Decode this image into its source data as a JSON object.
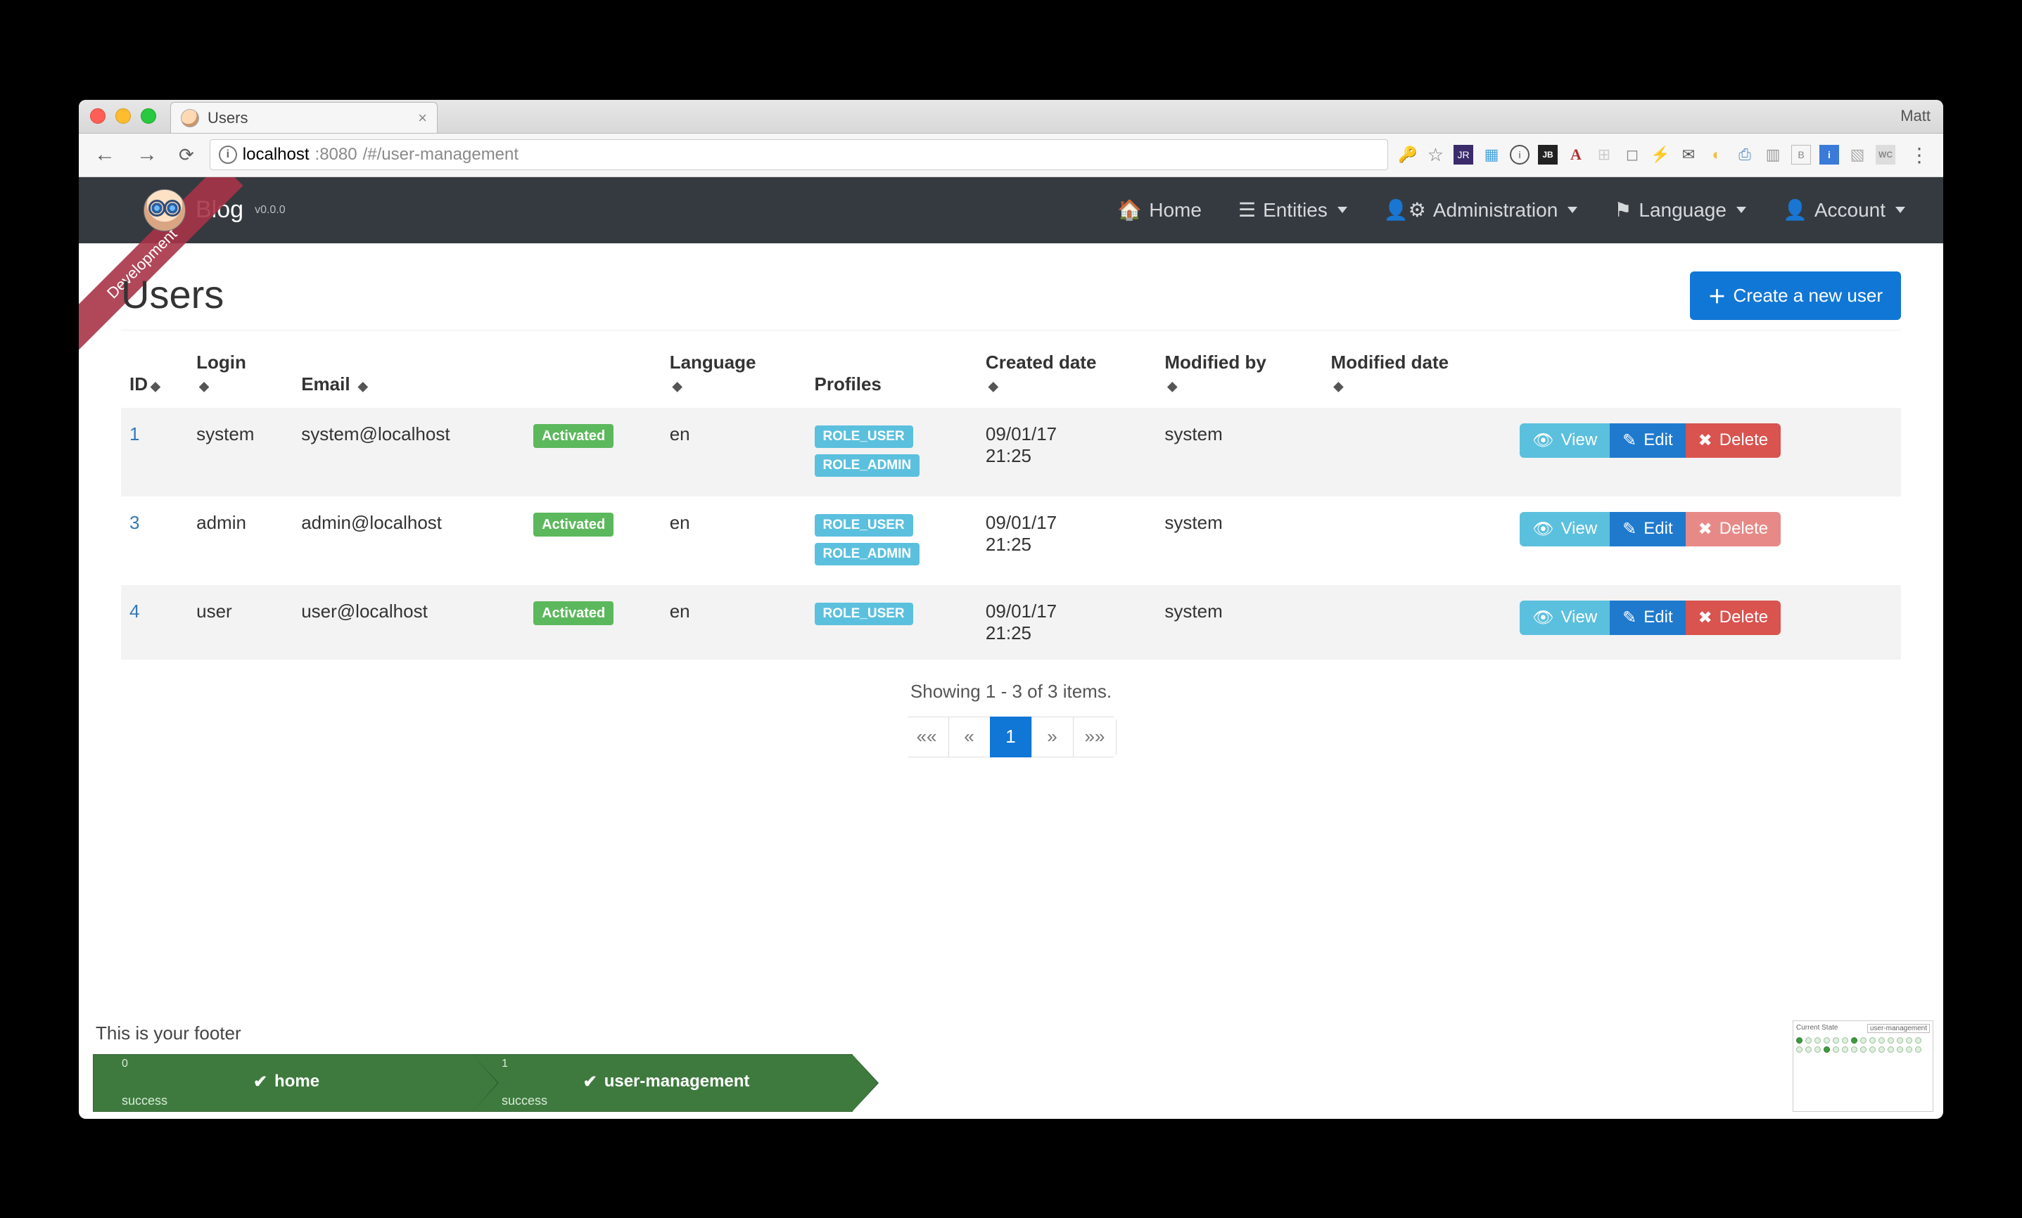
{
  "browser": {
    "tab_title": "Users",
    "profile_name": "Matt",
    "url_host": "localhost",
    "url_port": ":8080",
    "url_path": "/#/user-management"
  },
  "navbar": {
    "ribbon": "Development",
    "brand": "Blog",
    "version": "v0.0.0",
    "items": {
      "home": "Home",
      "entities": "Entities",
      "administration": "Administration",
      "language": "Language",
      "account": "Account"
    }
  },
  "page": {
    "title": "Users",
    "create_button": "Create a new user"
  },
  "table": {
    "headers": {
      "id": "ID",
      "login": "Login",
      "email": "Email",
      "language": "Language",
      "profiles": "Profiles",
      "created": "Created date",
      "modified_by": "Modified by",
      "modified_date": "Modified date"
    },
    "actions": {
      "view": "View",
      "edit": "Edit",
      "delete": "Delete"
    },
    "status_label": "Activated",
    "rows": [
      {
        "id": "1",
        "login": "system",
        "email": "system@localhost",
        "language": "en",
        "roles": [
          "ROLE_USER",
          "ROLE_ADMIN"
        ],
        "created": "09/01/17 21:25",
        "modified_by": "system",
        "delete_soft": false
      },
      {
        "id": "3",
        "login": "admin",
        "email": "admin@localhost",
        "language": "en",
        "roles": [
          "ROLE_USER",
          "ROLE_ADMIN"
        ],
        "created": "09/01/17 21:25",
        "modified_by": "system",
        "delete_soft": true
      },
      {
        "id": "4",
        "login": "user",
        "email": "user@localhost",
        "language": "en",
        "roles": [
          "ROLE_USER"
        ],
        "created": "09/01/17 21:25",
        "modified_by": "system",
        "delete_soft": false
      }
    ]
  },
  "pager": {
    "summary": "Showing 1 - 3 of 3 items.",
    "first": "««",
    "prev": "«",
    "current": "1",
    "next": "»",
    "last": "»»"
  },
  "footer": {
    "text": "This is your footer",
    "crumbs": [
      {
        "index": "0",
        "name": "home",
        "status": "success"
      },
      {
        "index": "1",
        "name": "user-management",
        "status": "success"
      }
    ],
    "mini_state_label": "Current State",
    "mini_state_value": "user-management"
  }
}
